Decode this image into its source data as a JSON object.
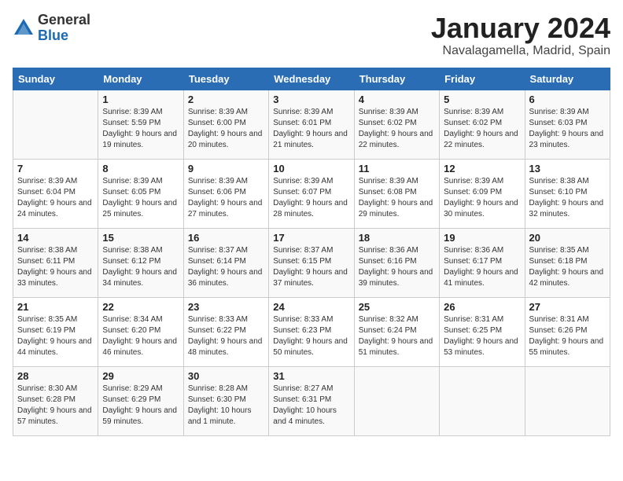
{
  "logo": {
    "general": "General",
    "blue": "Blue"
  },
  "header": {
    "title": "January 2024",
    "location": "Navalagamella, Madrid, Spain"
  },
  "weekdays": [
    "Sunday",
    "Monday",
    "Tuesday",
    "Wednesday",
    "Thursday",
    "Friday",
    "Saturday"
  ],
  "weeks": [
    [
      {
        "day": null
      },
      {
        "day": "1",
        "sunrise": "Sunrise: 8:39 AM",
        "sunset": "Sunset: 5:59 PM",
        "daylight": "Daylight: 9 hours and 19 minutes."
      },
      {
        "day": "2",
        "sunrise": "Sunrise: 8:39 AM",
        "sunset": "Sunset: 6:00 PM",
        "daylight": "Daylight: 9 hours and 20 minutes."
      },
      {
        "day": "3",
        "sunrise": "Sunrise: 8:39 AM",
        "sunset": "Sunset: 6:01 PM",
        "daylight": "Daylight: 9 hours and 21 minutes."
      },
      {
        "day": "4",
        "sunrise": "Sunrise: 8:39 AM",
        "sunset": "Sunset: 6:02 PM",
        "daylight": "Daylight: 9 hours and 22 minutes."
      },
      {
        "day": "5",
        "sunrise": "Sunrise: 8:39 AM",
        "sunset": "Sunset: 6:02 PM",
        "daylight": "Daylight: 9 hours and 22 minutes."
      },
      {
        "day": "6",
        "sunrise": "Sunrise: 8:39 AM",
        "sunset": "Sunset: 6:03 PM",
        "daylight": "Daylight: 9 hours and 23 minutes."
      }
    ],
    [
      {
        "day": "7",
        "sunrise": "Sunrise: 8:39 AM",
        "sunset": "Sunset: 6:04 PM",
        "daylight": "Daylight: 9 hours and 24 minutes."
      },
      {
        "day": "8",
        "sunrise": "Sunrise: 8:39 AM",
        "sunset": "Sunset: 6:05 PM",
        "daylight": "Daylight: 9 hours and 25 minutes."
      },
      {
        "day": "9",
        "sunrise": "Sunrise: 8:39 AM",
        "sunset": "Sunset: 6:06 PM",
        "daylight": "Daylight: 9 hours and 27 minutes."
      },
      {
        "day": "10",
        "sunrise": "Sunrise: 8:39 AM",
        "sunset": "Sunset: 6:07 PM",
        "daylight": "Daylight: 9 hours and 28 minutes."
      },
      {
        "day": "11",
        "sunrise": "Sunrise: 8:39 AM",
        "sunset": "Sunset: 6:08 PM",
        "daylight": "Daylight: 9 hours and 29 minutes."
      },
      {
        "day": "12",
        "sunrise": "Sunrise: 8:39 AM",
        "sunset": "Sunset: 6:09 PM",
        "daylight": "Daylight: 9 hours and 30 minutes."
      },
      {
        "day": "13",
        "sunrise": "Sunrise: 8:38 AM",
        "sunset": "Sunset: 6:10 PM",
        "daylight": "Daylight: 9 hours and 32 minutes."
      }
    ],
    [
      {
        "day": "14",
        "sunrise": "Sunrise: 8:38 AM",
        "sunset": "Sunset: 6:11 PM",
        "daylight": "Daylight: 9 hours and 33 minutes."
      },
      {
        "day": "15",
        "sunrise": "Sunrise: 8:38 AM",
        "sunset": "Sunset: 6:12 PM",
        "daylight": "Daylight: 9 hours and 34 minutes."
      },
      {
        "day": "16",
        "sunrise": "Sunrise: 8:37 AM",
        "sunset": "Sunset: 6:14 PM",
        "daylight": "Daylight: 9 hours and 36 minutes."
      },
      {
        "day": "17",
        "sunrise": "Sunrise: 8:37 AM",
        "sunset": "Sunset: 6:15 PM",
        "daylight": "Daylight: 9 hours and 37 minutes."
      },
      {
        "day": "18",
        "sunrise": "Sunrise: 8:36 AM",
        "sunset": "Sunset: 6:16 PM",
        "daylight": "Daylight: 9 hours and 39 minutes."
      },
      {
        "day": "19",
        "sunrise": "Sunrise: 8:36 AM",
        "sunset": "Sunset: 6:17 PM",
        "daylight": "Daylight: 9 hours and 41 minutes."
      },
      {
        "day": "20",
        "sunrise": "Sunrise: 8:35 AM",
        "sunset": "Sunset: 6:18 PM",
        "daylight": "Daylight: 9 hours and 42 minutes."
      }
    ],
    [
      {
        "day": "21",
        "sunrise": "Sunrise: 8:35 AM",
        "sunset": "Sunset: 6:19 PM",
        "daylight": "Daylight: 9 hours and 44 minutes."
      },
      {
        "day": "22",
        "sunrise": "Sunrise: 8:34 AM",
        "sunset": "Sunset: 6:20 PM",
        "daylight": "Daylight: 9 hours and 46 minutes."
      },
      {
        "day": "23",
        "sunrise": "Sunrise: 8:33 AM",
        "sunset": "Sunset: 6:22 PM",
        "daylight": "Daylight: 9 hours and 48 minutes."
      },
      {
        "day": "24",
        "sunrise": "Sunrise: 8:33 AM",
        "sunset": "Sunset: 6:23 PM",
        "daylight": "Daylight: 9 hours and 50 minutes."
      },
      {
        "day": "25",
        "sunrise": "Sunrise: 8:32 AM",
        "sunset": "Sunset: 6:24 PM",
        "daylight": "Daylight: 9 hours and 51 minutes."
      },
      {
        "day": "26",
        "sunrise": "Sunrise: 8:31 AM",
        "sunset": "Sunset: 6:25 PM",
        "daylight": "Daylight: 9 hours and 53 minutes."
      },
      {
        "day": "27",
        "sunrise": "Sunrise: 8:31 AM",
        "sunset": "Sunset: 6:26 PM",
        "daylight": "Daylight: 9 hours and 55 minutes."
      }
    ],
    [
      {
        "day": "28",
        "sunrise": "Sunrise: 8:30 AM",
        "sunset": "Sunset: 6:28 PM",
        "daylight": "Daylight: 9 hours and 57 minutes."
      },
      {
        "day": "29",
        "sunrise": "Sunrise: 8:29 AM",
        "sunset": "Sunset: 6:29 PM",
        "daylight": "Daylight: 9 hours and 59 minutes."
      },
      {
        "day": "30",
        "sunrise": "Sunrise: 8:28 AM",
        "sunset": "Sunset: 6:30 PM",
        "daylight": "Daylight: 10 hours and 1 minute."
      },
      {
        "day": "31",
        "sunrise": "Sunrise: 8:27 AM",
        "sunset": "Sunset: 6:31 PM",
        "daylight": "Daylight: 10 hours and 4 minutes."
      },
      {
        "day": null
      },
      {
        "day": null
      },
      {
        "day": null
      }
    ]
  ]
}
